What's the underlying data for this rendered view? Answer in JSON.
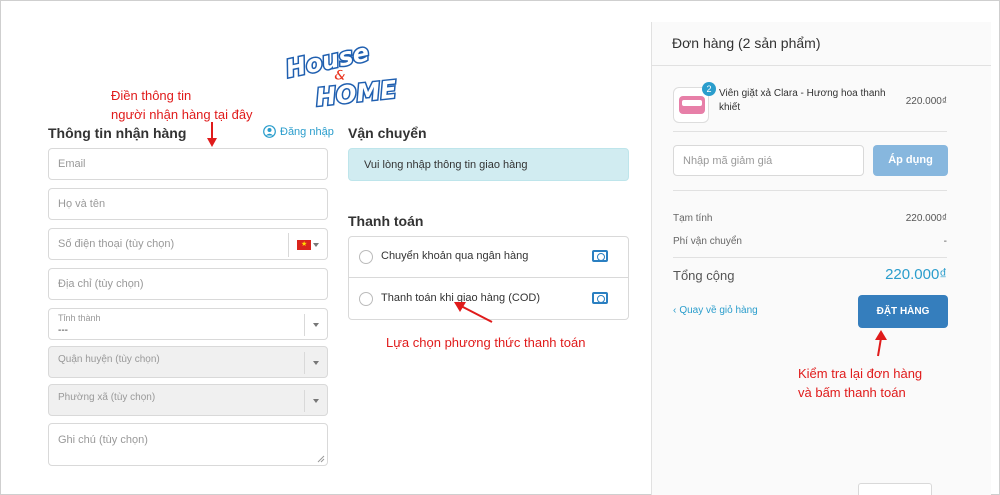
{
  "logo": {
    "line1": "House",
    "amp": "&",
    "line2": "HOME"
  },
  "annotations": {
    "fill_info": [
      "Điền thông tin",
      "người nhận hàng tại đây"
    ],
    "choose_payment": "Lựa chọn phương thức thanh toán",
    "check_order": [
      "Kiểm tra lại đơn hàng",
      "và bấm thanh toán"
    ]
  },
  "shipping_info": {
    "title": "Thông tin nhận hàng",
    "login_link": "Đăng nhập",
    "fields": {
      "email": "Email",
      "name": "Họ và tên",
      "phone": "Số điện thoại (tùy chọn)",
      "address": "Địa chỉ (tùy chọn)",
      "province_label": "Tỉnh thành",
      "province_value": "---",
      "district": "Quận huyện (tùy chọn)",
      "ward": "Phường xã (tùy chọn)",
      "note": "Ghi chú (tùy chọn)"
    }
  },
  "shipping": {
    "title": "Vận chuyển",
    "message": "Vui lòng nhập thông tin giao hàng"
  },
  "payment": {
    "title": "Thanh toán",
    "options": [
      {
        "label": "Chuyển khoản qua ngân hàng",
        "icon": "money-icon"
      },
      {
        "label": "Thanh toán khi giao hàng (COD)",
        "icon": "money-icon"
      }
    ]
  },
  "order": {
    "title": "Đơn hàng (2 sản phẩm)",
    "item": {
      "name_line1": "Viên giặt xả Clara - Hương hoa thanh",
      "name_line2": "khiết",
      "price": "220.000₫",
      "quantity": "2"
    },
    "discount_placeholder": "Nhập mã giảm giá",
    "apply_label": "Áp dụng",
    "subtotal_label": "Tạm tính",
    "subtotal_value": "220.000₫",
    "shipping_label": "Phí vận chuyển",
    "shipping_value": "-",
    "total_label": "Tổng cộng",
    "total_value": "220.000₫",
    "back_link": "Quay về giỏ hàng",
    "place_order": "ĐẶT HÀNG"
  },
  "colors": {
    "accent": "#357ebd",
    "link": "#2a9dcc",
    "annotation": "#e01b1b",
    "info_bg": "#d1ecf1",
    "apply_bg": "#87b7de"
  }
}
